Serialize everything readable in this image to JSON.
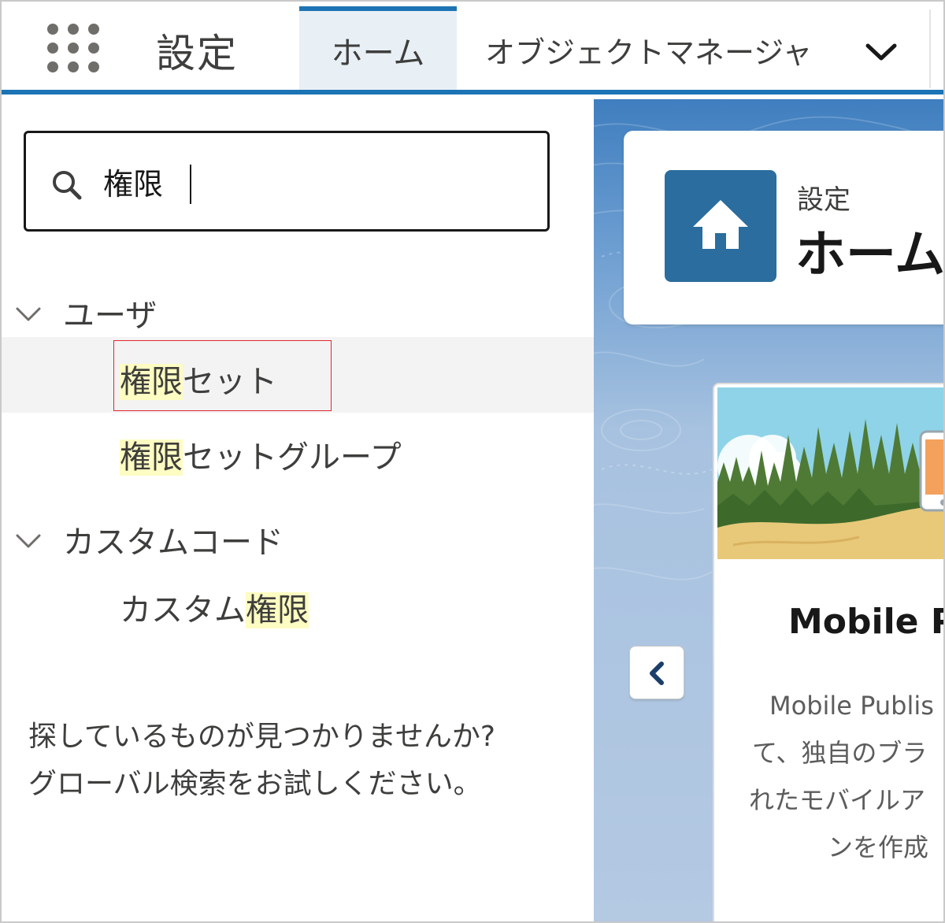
{
  "app": {
    "title": "設定"
  },
  "tabs": [
    {
      "label": "ホーム"
    },
    {
      "label": "オブジェクトマネージャ"
    }
  ],
  "search": {
    "value": "権限",
    "placeholder": ""
  },
  "sections": [
    {
      "label": "ユーザ",
      "items": [
        {
          "match": "権限",
          "rest": "セット"
        },
        {
          "match": "権限",
          "rest": "セットグループ"
        }
      ]
    },
    {
      "label": "カスタムコード",
      "items": [
        {
          "prefix": "カスタム",
          "match": "権限"
        }
      ]
    }
  ],
  "help": {
    "line1": "探しているものが見つかりませんか?",
    "line2": "グローバル検索をお試しください。"
  },
  "page_header": {
    "eyebrow": "設定",
    "title": "ホーム"
  },
  "promo": {
    "title": "Mobile P",
    "lines": [
      "Mobile Publis",
      "て、独自のブラ",
      "れたモバイルア",
      "ンを作成"
    ]
  },
  "colors": {
    "brand": "#1d74b5",
    "home_tile": "#2a6d9e",
    "highlight": "#fdfcc2",
    "focus_outline": "#e0262f"
  }
}
